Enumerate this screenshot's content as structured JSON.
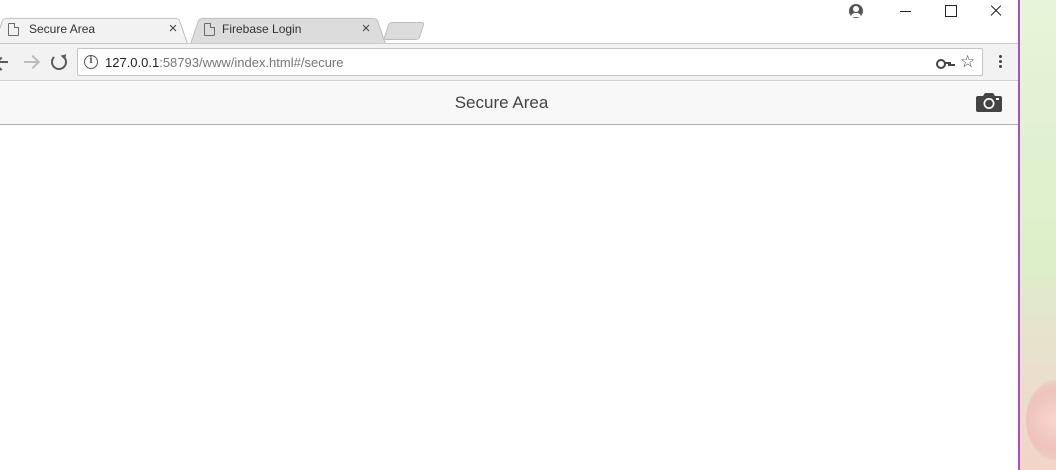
{
  "tabs": [
    {
      "title": "Secure Area",
      "active": true,
      "icon": "page-icon",
      "close_label": "×"
    },
    {
      "title": "Firebase Login",
      "active": false,
      "icon": "page-icon",
      "close_label": "×"
    }
  ],
  "window_controls": {
    "profile_icon": "profile-icon",
    "minimize_icon": "minimize-icon",
    "maximize_icon": "maximize-icon",
    "close_icon": "close-icon"
  },
  "toolbar": {
    "back_icon": "back-arrow-icon",
    "forward_icon": "forward-arrow-icon",
    "reload_icon": "reload-icon",
    "url_host": "127.0.0.1",
    "url_rest": ":58793/www/index.html#/secure",
    "star_glyph": "☆",
    "info_glyph": "i"
  },
  "app": {
    "title": "Secure Area",
    "camera_icon": "camera-icon"
  },
  "colors": {
    "tab_active": "#f2f2f2",
    "tab_inactive": "#dcdcdc",
    "header_bg": "#f8f8f8",
    "desktop_border": "#a84fc3"
  }
}
